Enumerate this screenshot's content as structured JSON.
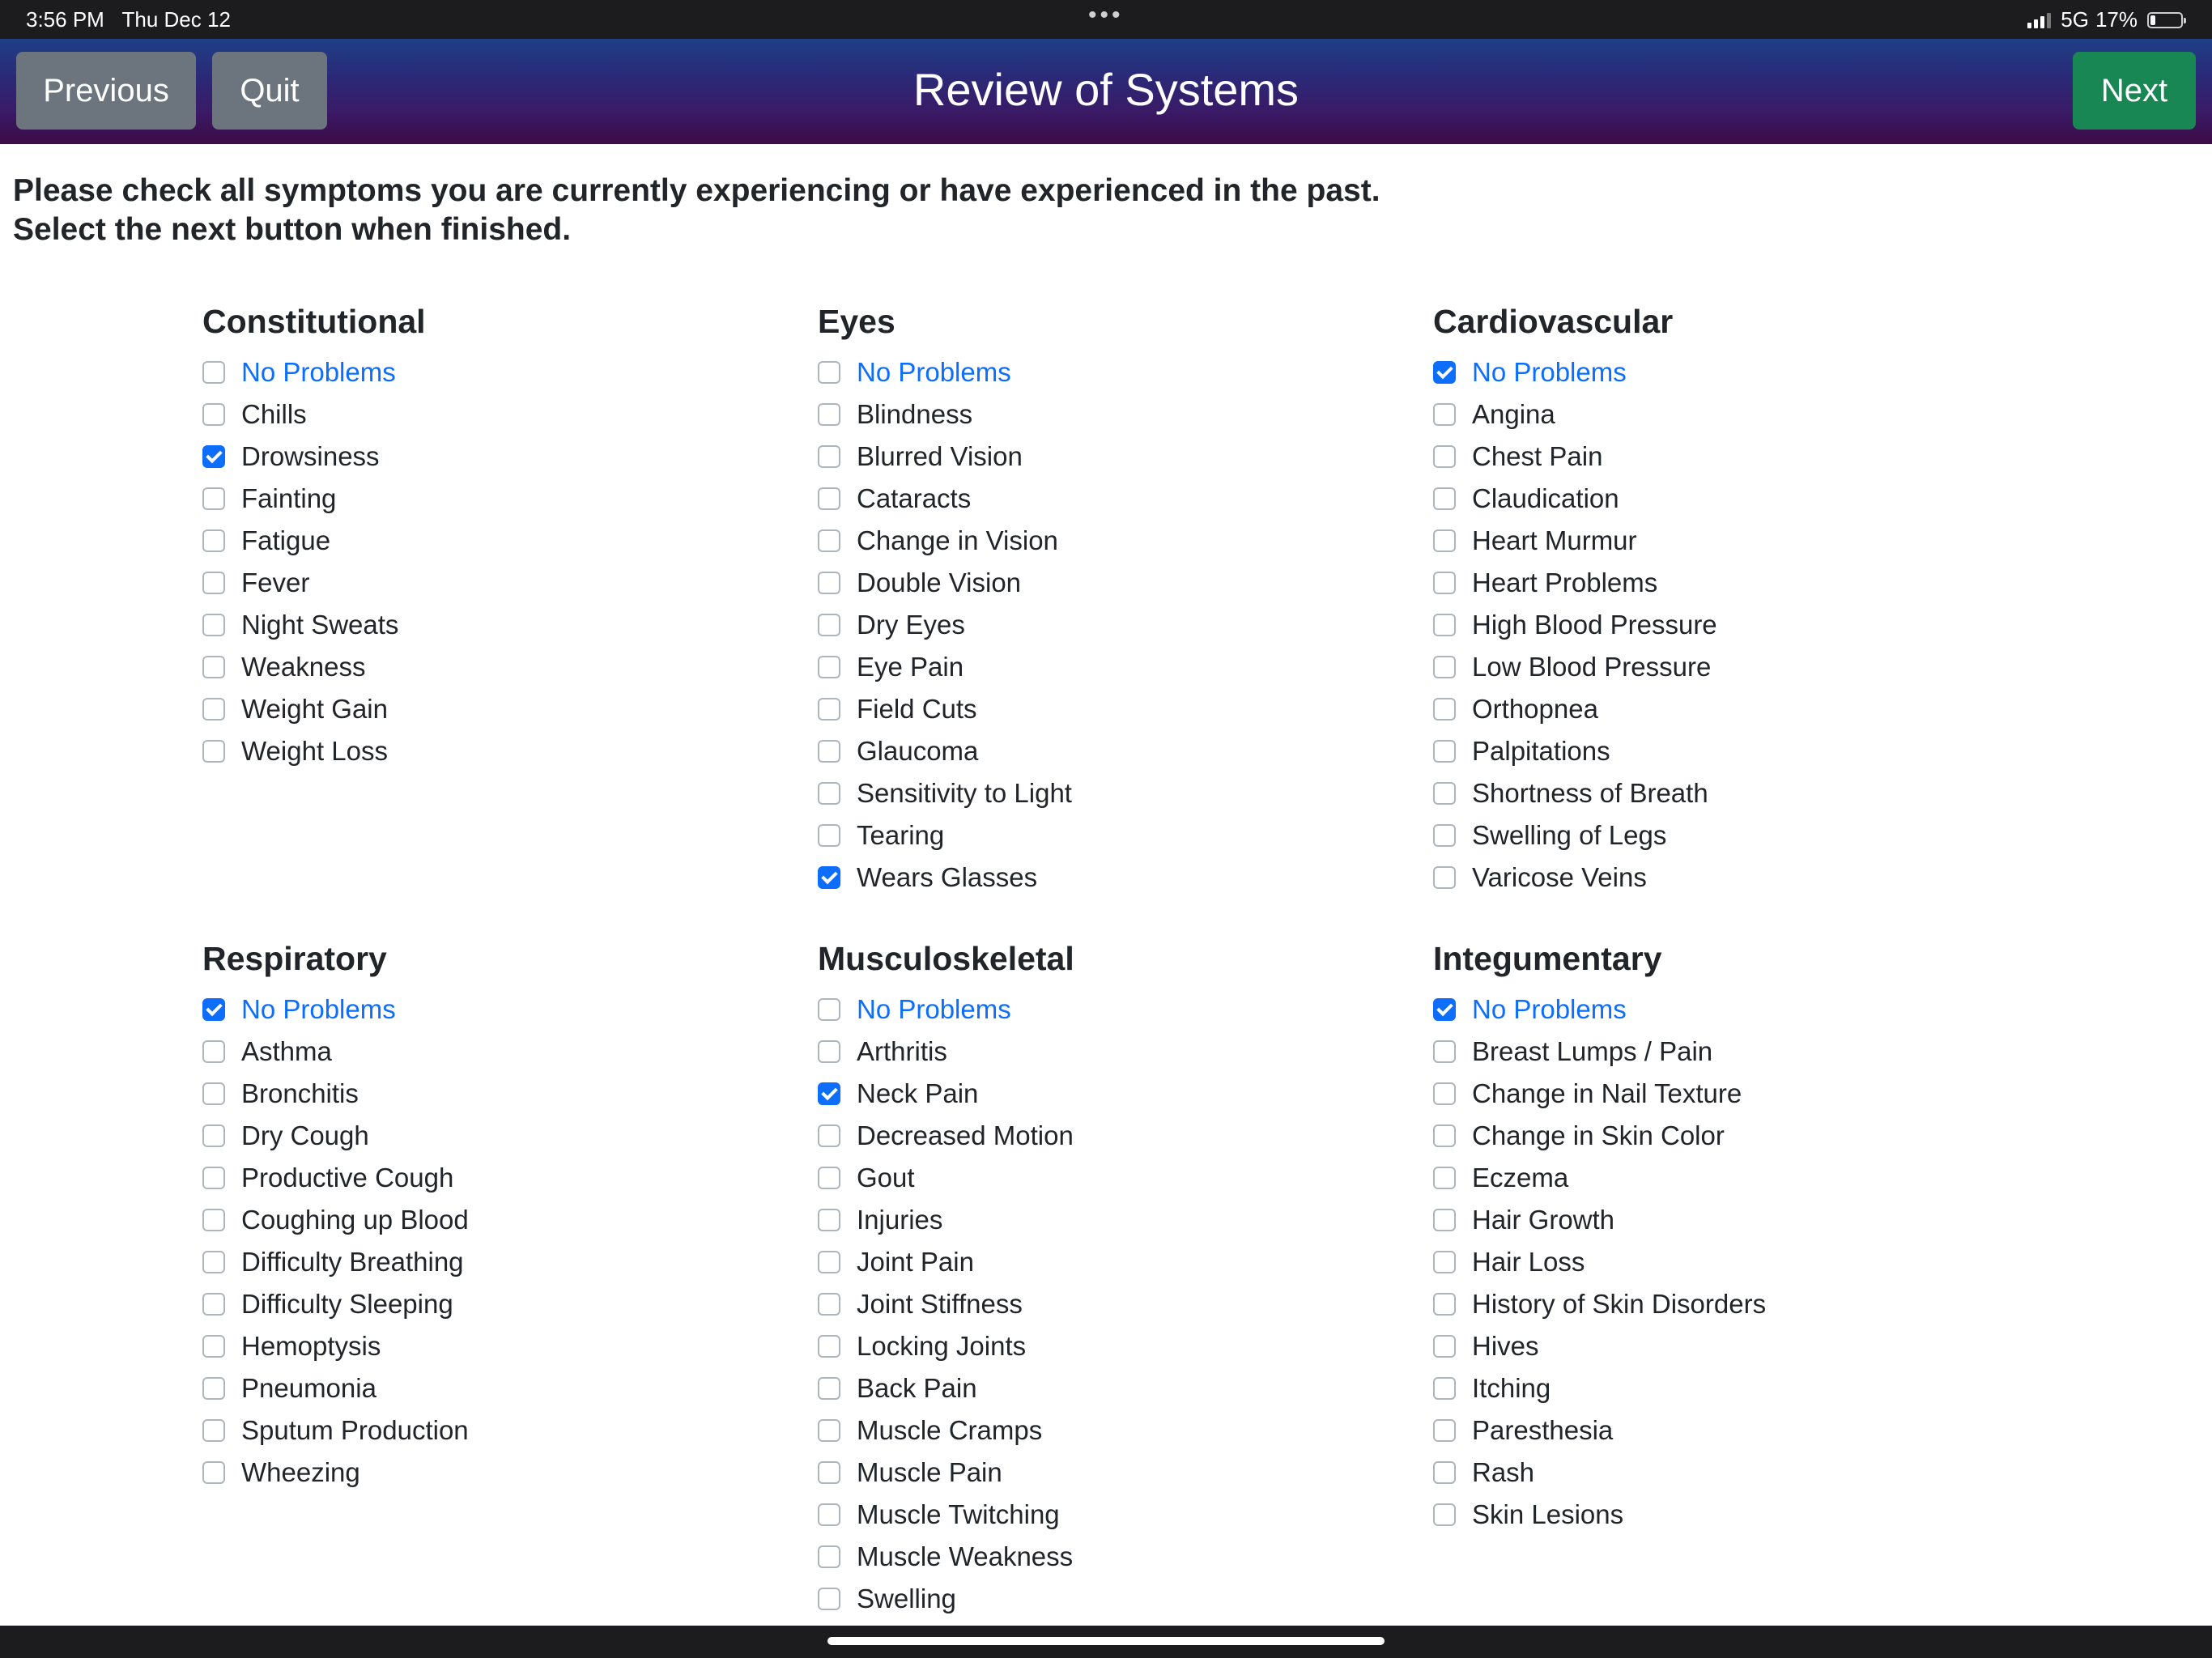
{
  "status_bar": {
    "time": "3:56 PM",
    "date": "Thu Dec 12",
    "multitask_dots": "•••",
    "network": "5G",
    "battery_percent": "17%",
    "battery_level": 0.17,
    "icons": [
      "signal-icon",
      "battery-icon"
    ]
  },
  "header": {
    "previous_label": "Previous",
    "quit_label": "Quit",
    "title": "Review of Systems",
    "next_label": "Next",
    "colors": {
      "gray_button": "#6c757d",
      "next_button": "#198754",
      "gradient_top": "#1f3f86",
      "gradient_bottom": "#3b0b45"
    }
  },
  "instructions": {
    "line1": "Please check all symptoms you are currently experiencing or have experienced in the past.",
    "line2": "Select the next button when finished."
  },
  "accent_color": "#0d6efd",
  "sections": [
    {
      "title": "Constitutional",
      "items": [
        {
          "label": "No Problems",
          "checked": false
        },
        {
          "label": "Chills",
          "checked": false
        },
        {
          "label": "Drowsiness",
          "checked": true
        },
        {
          "label": "Fainting",
          "checked": false
        },
        {
          "label": "Fatigue",
          "checked": false
        },
        {
          "label": "Fever",
          "checked": false
        },
        {
          "label": "Night Sweats",
          "checked": false
        },
        {
          "label": "Weakness",
          "checked": false
        },
        {
          "label": "Weight Gain",
          "checked": false
        },
        {
          "label": "Weight Loss",
          "checked": false
        }
      ]
    },
    {
      "title": "Eyes",
      "items": [
        {
          "label": "No Problems",
          "checked": false
        },
        {
          "label": "Blindness",
          "checked": false
        },
        {
          "label": "Blurred Vision",
          "checked": false
        },
        {
          "label": "Cataracts",
          "checked": false
        },
        {
          "label": "Change in Vision",
          "checked": false
        },
        {
          "label": "Double Vision",
          "checked": false
        },
        {
          "label": "Dry Eyes",
          "checked": false
        },
        {
          "label": "Eye Pain",
          "checked": false
        },
        {
          "label": "Field Cuts",
          "checked": false
        },
        {
          "label": "Glaucoma",
          "checked": false
        },
        {
          "label": "Sensitivity to Light",
          "checked": false
        },
        {
          "label": "Tearing",
          "checked": false
        },
        {
          "label": "Wears Glasses",
          "checked": true
        }
      ]
    },
    {
      "title": "Cardiovascular",
      "items": [
        {
          "label": "No Problems",
          "checked": true
        },
        {
          "label": "Angina",
          "checked": false
        },
        {
          "label": "Chest Pain",
          "checked": false
        },
        {
          "label": "Claudication",
          "checked": false
        },
        {
          "label": "Heart Murmur",
          "checked": false
        },
        {
          "label": "Heart Problems",
          "checked": false
        },
        {
          "label": "High Blood Pressure",
          "checked": false
        },
        {
          "label": "Low Blood Pressure",
          "checked": false
        },
        {
          "label": "Orthopnea",
          "checked": false
        },
        {
          "label": "Palpitations",
          "checked": false
        },
        {
          "label": "Shortness of Breath",
          "checked": false
        },
        {
          "label": "Swelling of Legs",
          "checked": false
        },
        {
          "label": "Varicose Veins",
          "checked": false
        }
      ]
    },
    {
      "title": "Respiratory",
      "items": [
        {
          "label": "No Problems",
          "checked": true
        },
        {
          "label": "Asthma",
          "checked": false
        },
        {
          "label": "Bronchitis",
          "checked": false
        },
        {
          "label": "Dry Cough",
          "checked": false
        },
        {
          "label": "Productive Cough",
          "checked": false
        },
        {
          "label": "Coughing up Blood",
          "checked": false
        },
        {
          "label": "Difficulty Breathing",
          "checked": false
        },
        {
          "label": "Difficulty Sleeping",
          "checked": false
        },
        {
          "label": "Hemoptysis",
          "checked": false
        },
        {
          "label": "Pneumonia",
          "checked": false
        },
        {
          "label": "Sputum Production",
          "checked": false
        },
        {
          "label": "Wheezing",
          "checked": false
        }
      ]
    },
    {
      "title": "Musculoskeletal",
      "items": [
        {
          "label": "No Problems",
          "checked": false
        },
        {
          "label": "Arthritis",
          "checked": false
        },
        {
          "label": "Neck Pain",
          "checked": true
        },
        {
          "label": "Decreased Motion",
          "checked": false
        },
        {
          "label": "Gout",
          "checked": false
        },
        {
          "label": "Injuries",
          "checked": false
        },
        {
          "label": "Joint Pain",
          "checked": false
        },
        {
          "label": "Joint Stiffness",
          "checked": false
        },
        {
          "label": "Locking Joints",
          "checked": false
        },
        {
          "label": "Back Pain",
          "checked": false
        },
        {
          "label": "Muscle Cramps",
          "checked": false
        },
        {
          "label": "Muscle Pain",
          "checked": false
        },
        {
          "label": "Muscle Twitching",
          "checked": false
        },
        {
          "label": "Muscle Weakness",
          "checked": false
        },
        {
          "label": "Swelling",
          "checked": false
        }
      ]
    },
    {
      "title": "Integumentary",
      "items": [
        {
          "label": "No Problems",
          "checked": true
        },
        {
          "label": "Breast Lumps / Pain",
          "checked": false
        },
        {
          "label": "Change in Nail Texture",
          "checked": false
        },
        {
          "label": "Change in Skin Color",
          "checked": false
        },
        {
          "label": "Eczema",
          "checked": false
        },
        {
          "label": "Hair Growth",
          "checked": false
        },
        {
          "label": "Hair Loss",
          "checked": false
        },
        {
          "label": "History of Skin Disorders",
          "checked": false
        },
        {
          "label": "Hives",
          "checked": false
        },
        {
          "label": "Itching",
          "checked": false
        },
        {
          "label": "Paresthesia",
          "checked": false
        },
        {
          "label": "Rash",
          "checked": false
        },
        {
          "label": "Skin Lesions",
          "checked": false
        }
      ]
    }
  ]
}
